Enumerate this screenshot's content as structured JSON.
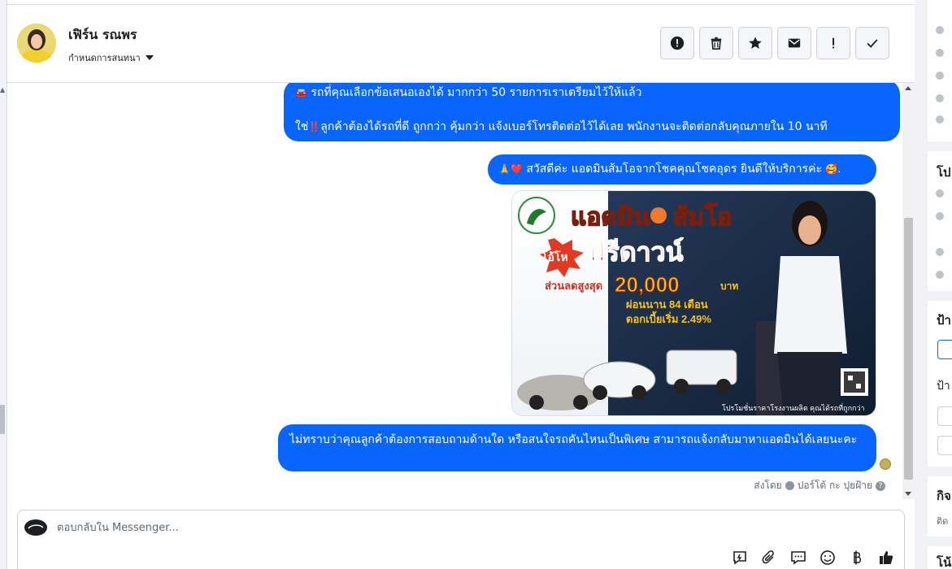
{
  "header": {
    "contact_name": "เฟิร์น รณพร",
    "assign_label": "กำหนดการสนทนา"
  },
  "actions": [
    {
      "name": "spam-button",
      "icon": "alert-circle-icon"
    },
    {
      "name": "delete-button",
      "icon": "trash-icon"
    },
    {
      "name": "star-button",
      "icon": "star-icon"
    },
    {
      "name": "mark-unread-button",
      "icon": "envelope-icon"
    },
    {
      "name": "follow-up-button",
      "icon": "exclamation-icon"
    },
    {
      "name": "mark-done-button",
      "icon": "check-icon"
    }
  ],
  "messages": {
    "m1_line1": "รถที่คุณเลือกข้อเสนอเองได้ มากกว่า 50 รายการเราเตรียมไว้ให้แล้ว",
    "m1_line2": "ลูกค้าต้องได้รถที่ดี ถูกกว่า คุ้มกว่า แจ้งเบอร์โทรติดต่อไว้ได้เลย พนักงานจะติดต่อกลับคุณภายใน 10 นาที",
    "m1_line2_prefix": "ใช่",
    "m1_line1_emoji": "🚘",
    "m1_line2_emoji": "‼️",
    "m2_emoji_start": "🙏❤️",
    "m2_text": "สวัสดีค่ะ แอดมินส้มโอจากโชคคุณโชคอุดร ยินดีให้บริการค่ะ",
    "m2_emoji_end": "🥰.",
    "m3_text": "ไม่ทราบว่าคุณลูกค้าต้องการสอบถามด้านใด หรือสนใจรถคันไหนเป็นพิเศษ สามารถแจ้งกลับมาหาแอดมินได้เลยนะคะ"
  },
  "promo": {
    "title_left": "แอดมิน",
    "title_right": "ส้มโอ",
    "burst": "โอ้โห",
    "headline": "ฟรีดาวน์",
    "discount_label": "ส่วนลดสูงสุด",
    "discount_value": "20,000",
    "discount_unit": "บาท",
    "installment": "ผ่อนนาน 84 เดือน",
    "interest": "ดอกเบี้ยเริ่ม 2.49%",
    "footer": "โปรโมชั่นราคาโรงงานผลิต คุณได้รถที่ถูกกว่า"
  },
  "sent_by": {
    "prefix": "ส่งโดย",
    "name": "ปอร์โต้ กะ ปุยฝ้าย",
    "help": "?"
  },
  "composer": {
    "placeholder": "ตอบกลับใน Messenger..."
  },
  "composer_tools": [
    "quick-reply-icon",
    "attachment-icon",
    "saved-reply-icon",
    "emoji-icon",
    "payment-icon",
    "thumbs-up-icon"
  ],
  "right_panel": {
    "sec1": "โป",
    "sec2": "ป้า",
    "sec2_sub": "ป้า",
    "sec3": "กิจ",
    "sec3_sub": "ติด",
    "sec4": "โน้"
  },
  "colors": {
    "bubble": "#0866ff",
    "panel_bg": "#f0f2f5"
  }
}
